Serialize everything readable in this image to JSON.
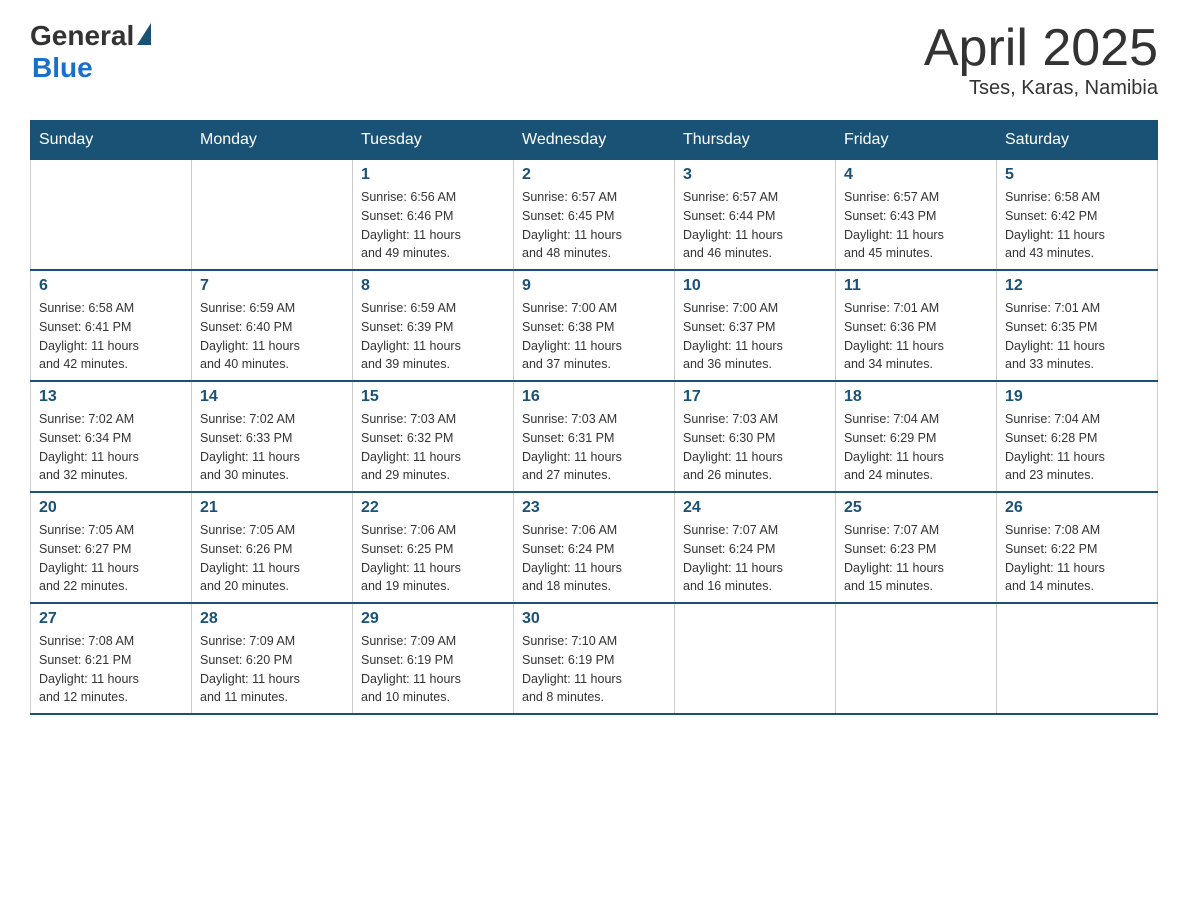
{
  "logo": {
    "general": "General",
    "blue": "Blue",
    "tagline": "Blue"
  },
  "title": {
    "month_year": "April 2025",
    "location": "Tses, Karas, Namibia"
  },
  "days_of_week": [
    "Sunday",
    "Monday",
    "Tuesday",
    "Wednesday",
    "Thursday",
    "Friday",
    "Saturday"
  ],
  "weeks": [
    [
      {
        "day": "",
        "info": ""
      },
      {
        "day": "",
        "info": ""
      },
      {
        "day": "1",
        "info": "Sunrise: 6:56 AM\nSunset: 6:46 PM\nDaylight: 11 hours\nand 49 minutes."
      },
      {
        "day": "2",
        "info": "Sunrise: 6:57 AM\nSunset: 6:45 PM\nDaylight: 11 hours\nand 48 minutes."
      },
      {
        "day": "3",
        "info": "Sunrise: 6:57 AM\nSunset: 6:44 PM\nDaylight: 11 hours\nand 46 minutes."
      },
      {
        "day": "4",
        "info": "Sunrise: 6:57 AM\nSunset: 6:43 PM\nDaylight: 11 hours\nand 45 minutes."
      },
      {
        "day": "5",
        "info": "Sunrise: 6:58 AM\nSunset: 6:42 PM\nDaylight: 11 hours\nand 43 minutes."
      }
    ],
    [
      {
        "day": "6",
        "info": "Sunrise: 6:58 AM\nSunset: 6:41 PM\nDaylight: 11 hours\nand 42 minutes."
      },
      {
        "day": "7",
        "info": "Sunrise: 6:59 AM\nSunset: 6:40 PM\nDaylight: 11 hours\nand 40 minutes."
      },
      {
        "day": "8",
        "info": "Sunrise: 6:59 AM\nSunset: 6:39 PM\nDaylight: 11 hours\nand 39 minutes."
      },
      {
        "day": "9",
        "info": "Sunrise: 7:00 AM\nSunset: 6:38 PM\nDaylight: 11 hours\nand 37 minutes."
      },
      {
        "day": "10",
        "info": "Sunrise: 7:00 AM\nSunset: 6:37 PM\nDaylight: 11 hours\nand 36 minutes."
      },
      {
        "day": "11",
        "info": "Sunrise: 7:01 AM\nSunset: 6:36 PM\nDaylight: 11 hours\nand 34 minutes."
      },
      {
        "day": "12",
        "info": "Sunrise: 7:01 AM\nSunset: 6:35 PM\nDaylight: 11 hours\nand 33 minutes."
      }
    ],
    [
      {
        "day": "13",
        "info": "Sunrise: 7:02 AM\nSunset: 6:34 PM\nDaylight: 11 hours\nand 32 minutes."
      },
      {
        "day": "14",
        "info": "Sunrise: 7:02 AM\nSunset: 6:33 PM\nDaylight: 11 hours\nand 30 minutes."
      },
      {
        "day": "15",
        "info": "Sunrise: 7:03 AM\nSunset: 6:32 PM\nDaylight: 11 hours\nand 29 minutes."
      },
      {
        "day": "16",
        "info": "Sunrise: 7:03 AM\nSunset: 6:31 PM\nDaylight: 11 hours\nand 27 minutes."
      },
      {
        "day": "17",
        "info": "Sunrise: 7:03 AM\nSunset: 6:30 PM\nDaylight: 11 hours\nand 26 minutes."
      },
      {
        "day": "18",
        "info": "Sunrise: 7:04 AM\nSunset: 6:29 PM\nDaylight: 11 hours\nand 24 minutes."
      },
      {
        "day": "19",
        "info": "Sunrise: 7:04 AM\nSunset: 6:28 PM\nDaylight: 11 hours\nand 23 minutes."
      }
    ],
    [
      {
        "day": "20",
        "info": "Sunrise: 7:05 AM\nSunset: 6:27 PM\nDaylight: 11 hours\nand 22 minutes."
      },
      {
        "day": "21",
        "info": "Sunrise: 7:05 AM\nSunset: 6:26 PM\nDaylight: 11 hours\nand 20 minutes."
      },
      {
        "day": "22",
        "info": "Sunrise: 7:06 AM\nSunset: 6:25 PM\nDaylight: 11 hours\nand 19 minutes."
      },
      {
        "day": "23",
        "info": "Sunrise: 7:06 AM\nSunset: 6:24 PM\nDaylight: 11 hours\nand 18 minutes."
      },
      {
        "day": "24",
        "info": "Sunrise: 7:07 AM\nSunset: 6:24 PM\nDaylight: 11 hours\nand 16 minutes."
      },
      {
        "day": "25",
        "info": "Sunrise: 7:07 AM\nSunset: 6:23 PM\nDaylight: 11 hours\nand 15 minutes."
      },
      {
        "day": "26",
        "info": "Sunrise: 7:08 AM\nSunset: 6:22 PM\nDaylight: 11 hours\nand 14 minutes."
      }
    ],
    [
      {
        "day": "27",
        "info": "Sunrise: 7:08 AM\nSunset: 6:21 PM\nDaylight: 11 hours\nand 12 minutes."
      },
      {
        "day": "28",
        "info": "Sunrise: 7:09 AM\nSunset: 6:20 PM\nDaylight: 11 hours\nand 11 minutes."
      },
      {
        "day": "29",
        "info": "Sunrise: 7:09 AM\nSunset: 6:19 PM\nDaylight: 11 hours\nand 10 minutes."
      },
      {
        "day": "30",
        "info": "Sunrise: 7:10 AM\nSunset: 6:19 PM\nDaylight: 11 hours\nand 8 minutes."
      },
      {
        "day": "",
        "info": ""
      },
      {
        "day": "",
        "info": ""
      },
      {
        "day": "",
        "info": ""
      }
    ]
  ]
}
